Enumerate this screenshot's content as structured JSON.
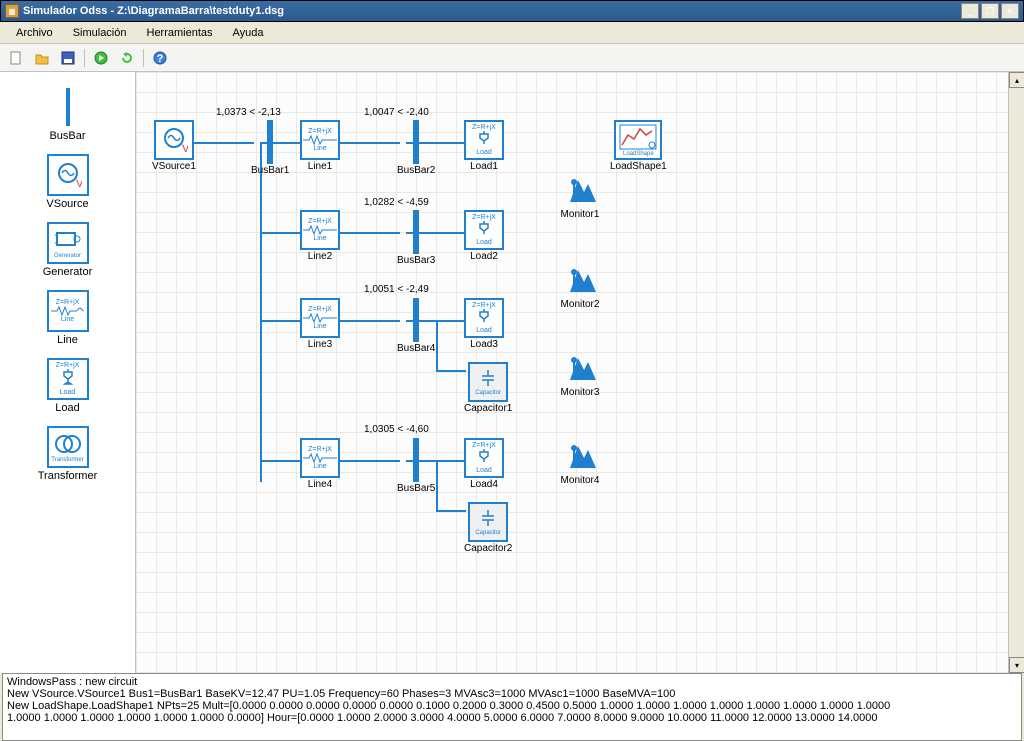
{
  "title": "Simulador Odss - Z:\\DiagramaBarra\\testduty1.dsg",
  "menu": {
    "file": "Archivo",
    "sim": "Simulación",
    "tools": "Herramientas",
    "help": "Ayuda"
  },
  "palette": {
    "busbar": "BusBar",
    "vsource": "VSource",
    "generator": "Generator",
    "line": "Line",
    "load": "Load",
    "transformer": "Transformer"
  },
  "nodes": {
    "vsource1": "VSource1",
    "busbar1": "BusBar1",
    "busbar2": "BusBar2",
    "busbar3": "BusBar3",
    "busbar4": "BusBar4",
    "busbar5": "BusBar5",
    "line1": "Line1",
    "line2": "Line2",
    "line3": "Line3",
    "line4": "Line4",
    "load1": "Load1",
    "load2": "Load2",
    "load3": "Load3",
    "load4": "Load4",
    "capacitor1": "Capacitor1",
    "capacitor2": "Capacitor2",
    "loadshape1": "LoadShape1",
    "monitor1": "Monitor1",
    "monitor2": "Monitor2",
    "monitor3": "Monitor3",
    "monitor4": "Monitor4"
  },
  "volt": {
    "b1": "1,0373 < -2,13",
    "b2": "1,0047 < -2,40",
    "b3": "1,0282 < -4,59",
    "b4": "1,0051 < -2,49",
    "b5": "1,0305 < -4,60"
  },
  "box_text": {
    "zrx": "Z=R+jX",
    "line": "Line",
    "load": "Load",
    "cap": "Capacitor",
    "gen": "Generator",
    "trans": "Transformer",
    "ls": "LoadShape",
    "v": "V"
  },
  "console": {
    "l1": "WindowsPass : new circuit",
    "l2": "New VSource.VSource1 Bus1=BusBar1 BaseKV=12.47 PU=1.05 Frequency=60 Phases=3 MVAsc3=1000 MVAsc1=1000 BaseMVA=100",
    "l3": "New LoadShape.LoadShape1 NPts=25 Mult=[0.0000 0.0000 0.0000 0.0000 0.0000 0.1000 0.2000 0.3000 0.4500 0.5000 1.0000 1.0000 1.0000 1.0000 1.0000 1.0000 1.0000 1.0000",
    "l4": "1.0000 1.0000 1.0000 1.0000 1.0000 1.0000 0.0000] Hour=[0.0000 1.0000 2.0000 3.0000 4.0000 5.0000 6.0000 7.0000 8.0000 9.0000 10.0000 11.0000 12.0000 13.0000 14.0000"
  }
}
